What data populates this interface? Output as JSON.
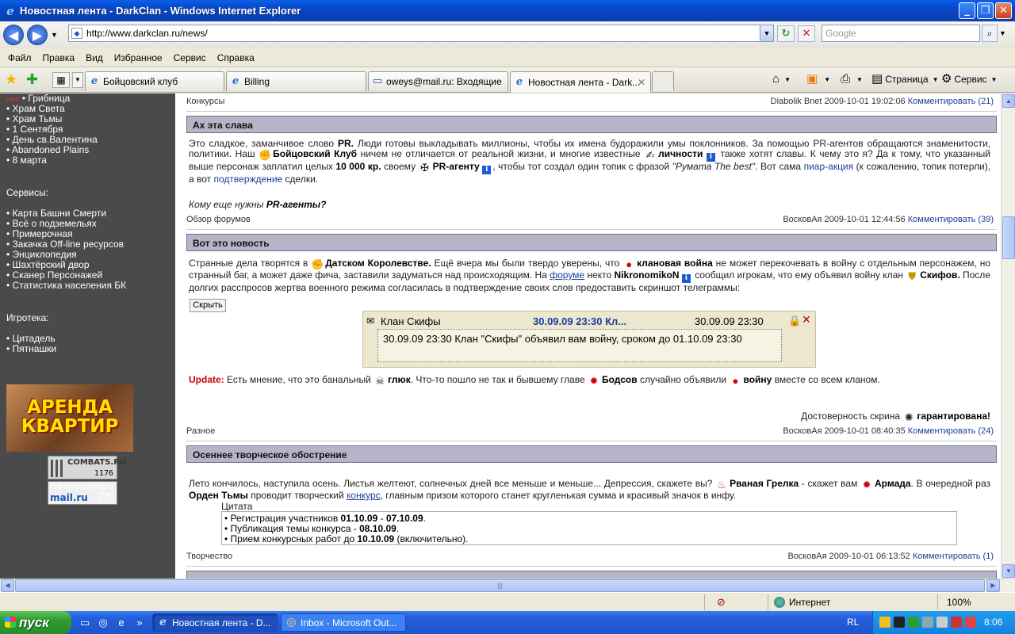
{
  "window": {
    "title": "Новостная лента - DarkClan - Windows Internet Explorer",
    "minimize": "_",
    "maximize": "❐",
    "close": "✕"
  },
  "navbar": {
    "back": "◀",
    "forward": "▶",
    "url": "http://www.darkclan.ru/news/",
    "search_placeholder": "Google",
    "refresh": "↻",
    "stop": "✕"
  },
  "menu": [
    "Файл",
    "Правка",
    "Вид",
    "Избранное",
    "Сервис",
    "Справка"
  ],
  "tabs": [
    {
      "label": "Бойцовский клуб",
      "active": false
    },
    {
      "label": "Billing",
      "active": false
    },
    {
      "label": "oweys@mail.ru: Входящие",
      "active": false
    },
    {
      "label": "Новостная лента - Dark...",
      "active": true
    }
  ],
  "toolbar_right": {
    "page": "Страница",
    "tools": "Сервис"
  },
  "sidebar": {
    "new_tag": "new",
    "items_top": [
      "• Грибница",
      "• Храм Света",
      "• Храм Тьмы",
      "• 1 Сентября",
      "• День св.Валентина",
      "• Abandoned Plains",
      "• 8 марта"
    ],
    "services_title": "Сервисы:",
    "services": [
      "• Карта Башни Смерти",
      "• Всё о подземельях",
      "• Примерочная",
      "• Закачка Off-line ресурсов",
      "• Энциклопедия",
      "• Шахтёрский двор",
      "• Сканер Персонажей",
      "• Статистика населения БК"
    ],
    "games_title": "Игротека:",
    "games": [
      "• Цитадель",
      "• Пятнашки"
    ],
    "banner_line1": "АРЕНДА",
    "banner_line2": "КВАРТИР",
    "counter1_label": "COMBATS.RU",
    "counter1_value": "1176",
    "counter2_label": "РЕЙТИНГ",
    "counter2_value1": "52674172",
    "counter2_brand": "mail.ru",
    "counter2_value2": "7547",
    "counter2_value3": "2739"
  },
  "posts": {
    "p0_meta": {
      "category": "Конкурсы",
      "author": "Diabolik Bnet 2009-10-01 19:02:06",
      "comments": "Комментировать (21)"
    },
    "p1": {
      "title": "Ах эта слава",
      "meta": {
        "category": "Обзор форумов",
        "author": "ВосковАя 2009-10-01 12:44:56",
        "comments": "Комментировать (39)"
      }
    },
    "p2": {
      "title": "Вот это новость",
      "hide_button": "Скрыть",
      "telegram": {
        "clan": "Клан Скифы",
        "datetime_link": "30.09.09 23:30 Кл...",
        "datetime": "30.09.09 23:30",
        "body": "30.09.09 23:30 Клан \"Скифы\" объявил вам войну, сроком до 01.10.09 23:30"
      },
      "credibility_label": "Достоверность скрина",
      "credibility_value": "гарантирована!",
      "meta": {
        "category": "Разное",
        "author": "ВосковАя 2009-10-01 08:40:35",
        "comments": "Комментировать (24)"
      }
    },
    "p3": {
      "title": "Осеннее творческое обострение",
      "quote_label": "Цитата",
      "meta": {
        "category": "Творчество",
        "author": "ВосковАя 2009-10-01 06:13:52",
        "comments": "Комментировать (1)"
      }
    }
  },
  "statusbar": {
    "zone": "Интернет",
    "zoom": "100%"
  },
  "taskbar": {
    "start": "пуск",
    "tasks": [
      "Новостная лента - D...",
      "Inbox - Microsoft Out..."
    ],
    "lang": "RL",
    "clock": "8:06"
  }
}
